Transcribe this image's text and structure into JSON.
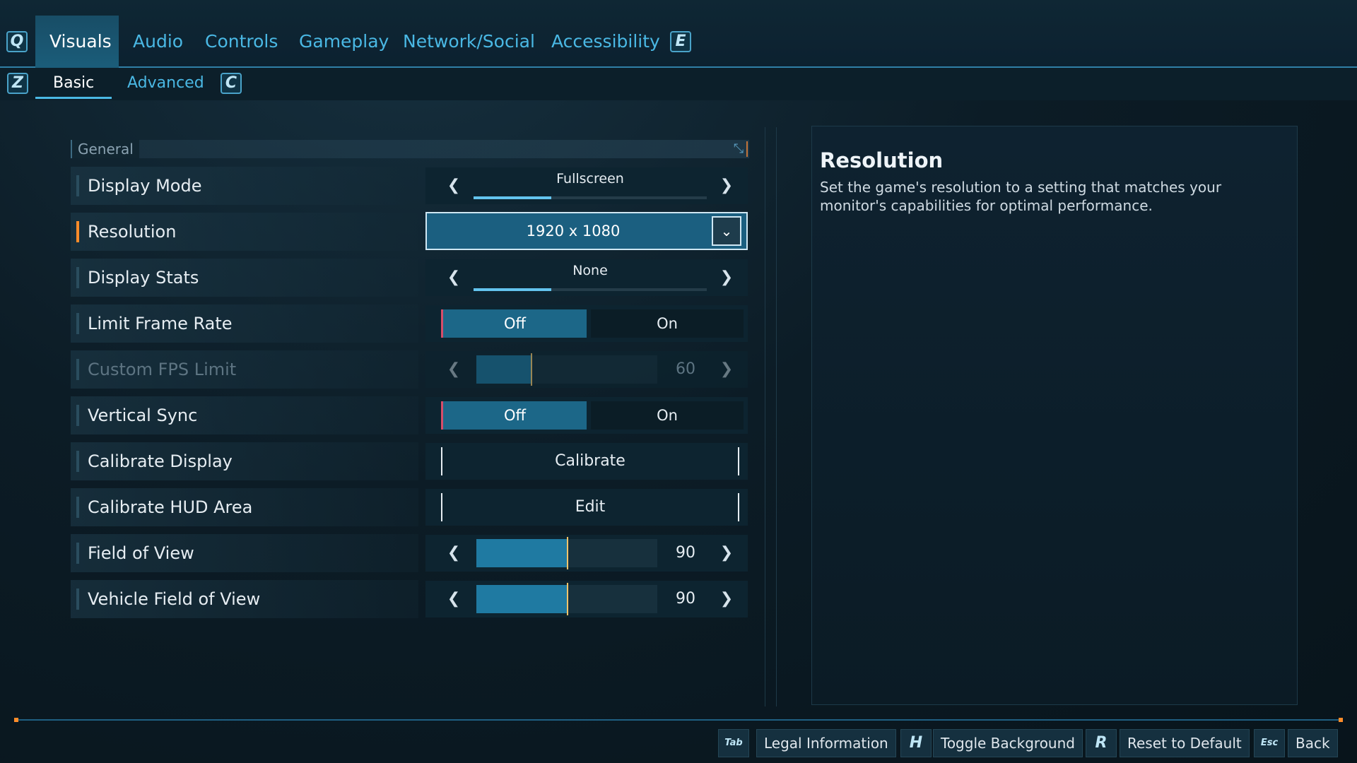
{
  "top_tabs": {
    "prev_key": "Q",
    "next_key": "E",
    "items": [
      {
        "label": "Visuals"
      },
      {
        "label": "Audio"
      },
      {
        "label": "Controls"
      },
      {
        "label": "Gameplay"
      },
      {
        "label": "Network/Social"
      },
      {
        "label": "Accessibility"
      }
    ],
    "active": "Visuals"
  },
  "sub_tabs": {
    "prev_key": "Z",
    "next_key": "C",
    "items": [
      {
        "label": "Basic"
      },
      {
        "label": "Advanced"
      }
    ],
    "active": "Basic"
  },
  "section": {
    "label": "General"
  },
  "settings": {
    "display_mode": {
      "label": "Display Mode",
      "value": "Fullscreen",
      "option_index": 0,
      "option_count": 3
    },
    "resolution": {
      "label": "Resolution",
      "value": "1920 x 1080"
    },
    "display_stats": {
      "label": "Display Stats",
      "value": "None",
      "option_index": 0,
      "option_count": 3
    },
    "limit_frame_rate": {
      "label": "Limit Frame Rate",
      "off_label": "Off",
      "on_label": "On",
      "selected": "Off"
    },
    "custom_fps_limit": {
      "label": "Custom FPS Limit",
      "value": "60",
      "fill_fraction": 0.3,
      "disabled": true
    },
    "vertical_sync": {
      "label": "Vertical Sync",
      "off_label": "Off",
      "on_label": "On",
      "selected": "Off"
    },
    "calibrate_display": {
      "label": "Calibrate Display",
      "button_label": "Calibrate"
    },
    "calibrate_hud_area": {
      "label": "Calibrate HUD Area",
      "button_label": "Edit"
    },
    "field_of_view": {
      "label": "Field of View",
      "value": "90",
      "fill_fraction": 0.5
    },
    "vehicle_field_of_view": {
      "label": "Vehicle Field of View",
      "value": "90",
      "fill_fraction": 0.5
    }
  },
  "info": {
    "title": "Resolution",
    "description": "Set the game's resolution to a setting that matches your monitor's capabilities for optimal performance."
  },
  "footer": {
    "legal": {
      "key": "Tab",
      "label": "Legal Information"
    },
    "toggle_bg": {
      "key": "H",
      "label": "Toggle Background"
    },
    "reset": {
      "key": "R",
      "label": "Reset to Default"
    },
    "back": {
      "key": "Esc",
      "label": "Back"
    }
  },
  "colors": {
    "accent": "#4ab8e4",
    "highlight": "#ff8c2a",
    "fill": "#1f7aa2",
    "selected_bg": "#1b5f80"
  }
}
